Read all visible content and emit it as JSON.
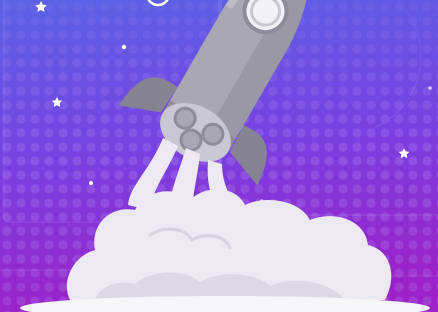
{
  "illustration": {
    "subject": "rocket-launch",
    "elements": [
      "rocket",
      "crescent-moon",
      "stars",
      "smoke-cloud",
      "ground-plate"
    ]
  },
  "colors": {
    "bg_top": "#5a63e6",
    "bg_mid": "#7a3fe0",
    "bg_bottom": "#9b22c8",
    "dots": "#b58cf2",
    "moon": "#f2f1f7",
    "rocket_body": "#a9a7b3",
    "rocket_shadow": "#8e8c99",
    "rocket_light": "#c9c7d1",
    "fin": "#868493",
    "smoke": "#ece9f2",
    "smoke_shadow": "#d6d2df",
    "star": "#ffffff"
  }
}
